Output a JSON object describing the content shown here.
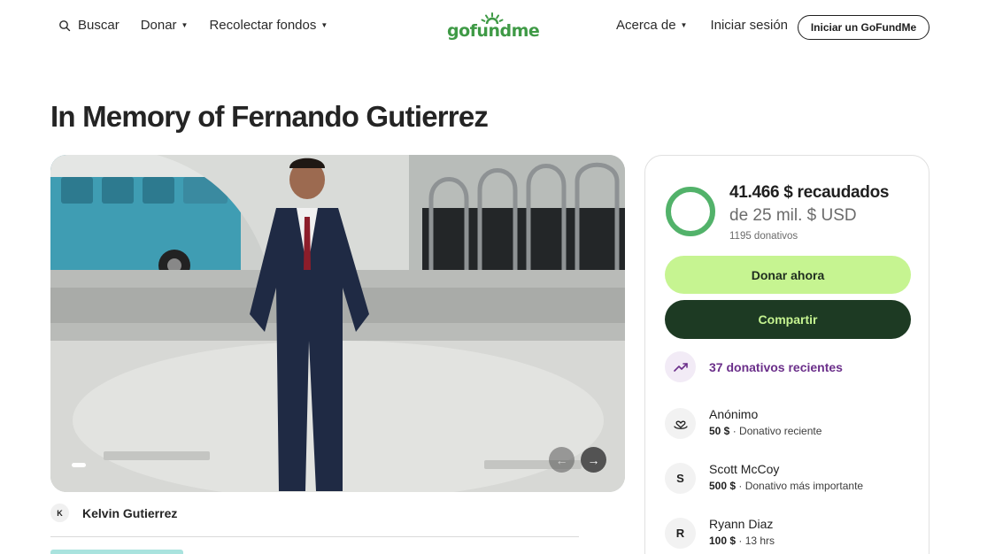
{
  "header": {
    "search_label": "Buscar",
    "donate_label": "Donar",
    "fundraise_label": "Recolectar fondos",
    "logo_text": "gofundme",
    "about_label": "Acerca de",
    "signin_label": "Iniciar sesión",
    "start_label": "Iniciar un GoFundMe"
  },
  "campaign": {
    "title": "In Memory of Fernando Gutierrez",
    "organizer_initial": "K",
    "organizer_name": "Kelvin Gutierrez"
  },
  "gallery": {
    "prev_icon": "arrow-left-icon",
    "next_icon": "arrow-right-icon"
  },
  "summary": {
    "raised": "41.466 $ recaudados",
    "goal": "de 25 mil. $ USD",
    "donation_count": "1195 donativos",
    "progress_fraction": 1.0,
    "donate_button": "Donar ahora",
    "share_button": "Compartir",
    "recent_label": "37 donativos recientes"
  },
  "donors": [
    {
      "initial": "",
      "icon": "heart-hand-icon",
      "name": "Anónimo",
      "amount": "50 $",
      "note": " · Donativo reciente"
    },
    {
      "initial": "S",
      "name": "Scott McCoy",
      "amount": "500 $",
      "note": " · Donativo más importante"
    },
    {
      "initial": "R",
      "name": "Ryann Diaz",
      "amount": "100 $",
      "note": " · 13 hrs"
    }
  ],
  "colors": {
    "brand_green": "#3f9a46",
    "donate_bg": "#c6f491",
    "share_bg": "#1d3a23",
    "recent_purple": "#6b2f8a"
  }
}
